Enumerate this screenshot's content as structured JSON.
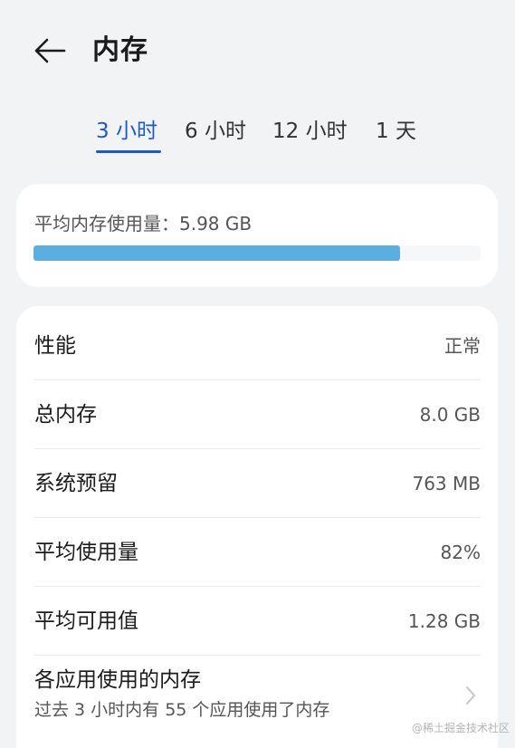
{
  "header": {
    "title": "内存",
    "back_icon": "arrow-left-icon"
  },
  "tabs": [
    {
      "label": "3 小时",
      "active": true
    },
    {
      "label": "6 小时",
      "active": false
    },
    {
      "label": "12 小时",
      "active": false
    },
    {
      "label": "1 天",
      "active": false
    }
  ],
  "average": {
    "label": "平均内存使用量：5.98 GB",
    "progress_fraction": 0.82,
    "bar_color": "#5aaee0"
  },
  "stats": [
    {
      "label": "性能",
      "value": "正常"
    },
    {
      "label": "总内存",
      "value": "8.0 GB"
    },
    {
      "label": "系统预留",
      "value": "763 MB"
    },
    {
      "label": "平均使用量",
      "value": "82%"
    },
    {
      "label": "平均可用值",
      "value": "1.28 GB"
    }
  ],
  "app_usage": {
    "title": "各应用使用的内存",
    "subtitle": "过去 3 小时内有 55 个应用使用了内存",
    "chevron_icon": "chevron-right-icon"
  },
  "watermark": "@稀土掘金技术社区",
  "colors": {
    "accent": "#1f59c6",
    "background": "#f1f3f5",
    "card": "#ffffff"
  }
}
